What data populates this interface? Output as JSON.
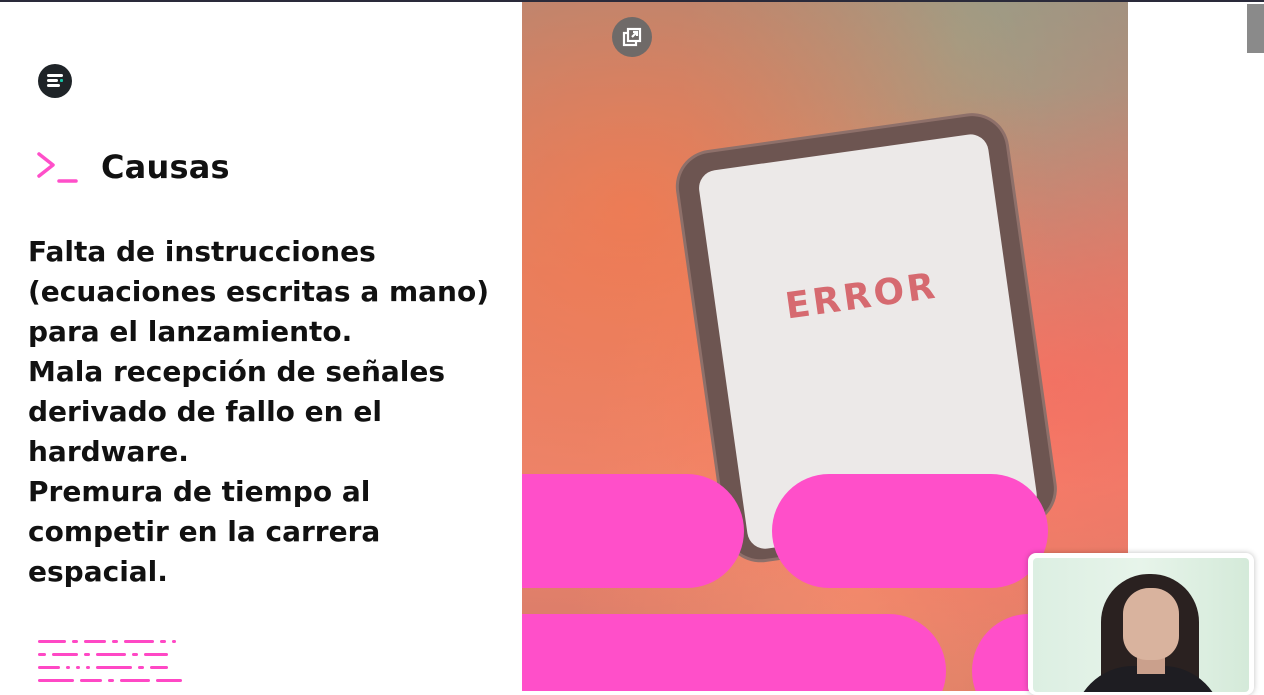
{
  "slide": {
    "section_title": "Causas",
    "paragraphs": [
      "Falta de instrucciones (ecuaciones escritas a mano) para el lanzamiento.",
      "Mala recepción de señales derivado de fallo en el hardware.",
      "Premura de tiempo al competir en la carrera espacial."
    ],
    "photo_text": "ERROR"
  },
  "icons": {
    "logo": "app-logo-icon",
    "section_marker": "terminal-prompt-icon",
    "expand": "open-external-icon"
  },
  "colors": {
    "accent": "#ff4fc9",
    "title": "#111111",
    "logo_bg": "#1f2428",
    "logo_dot": "#19c6a8"
  }
}
